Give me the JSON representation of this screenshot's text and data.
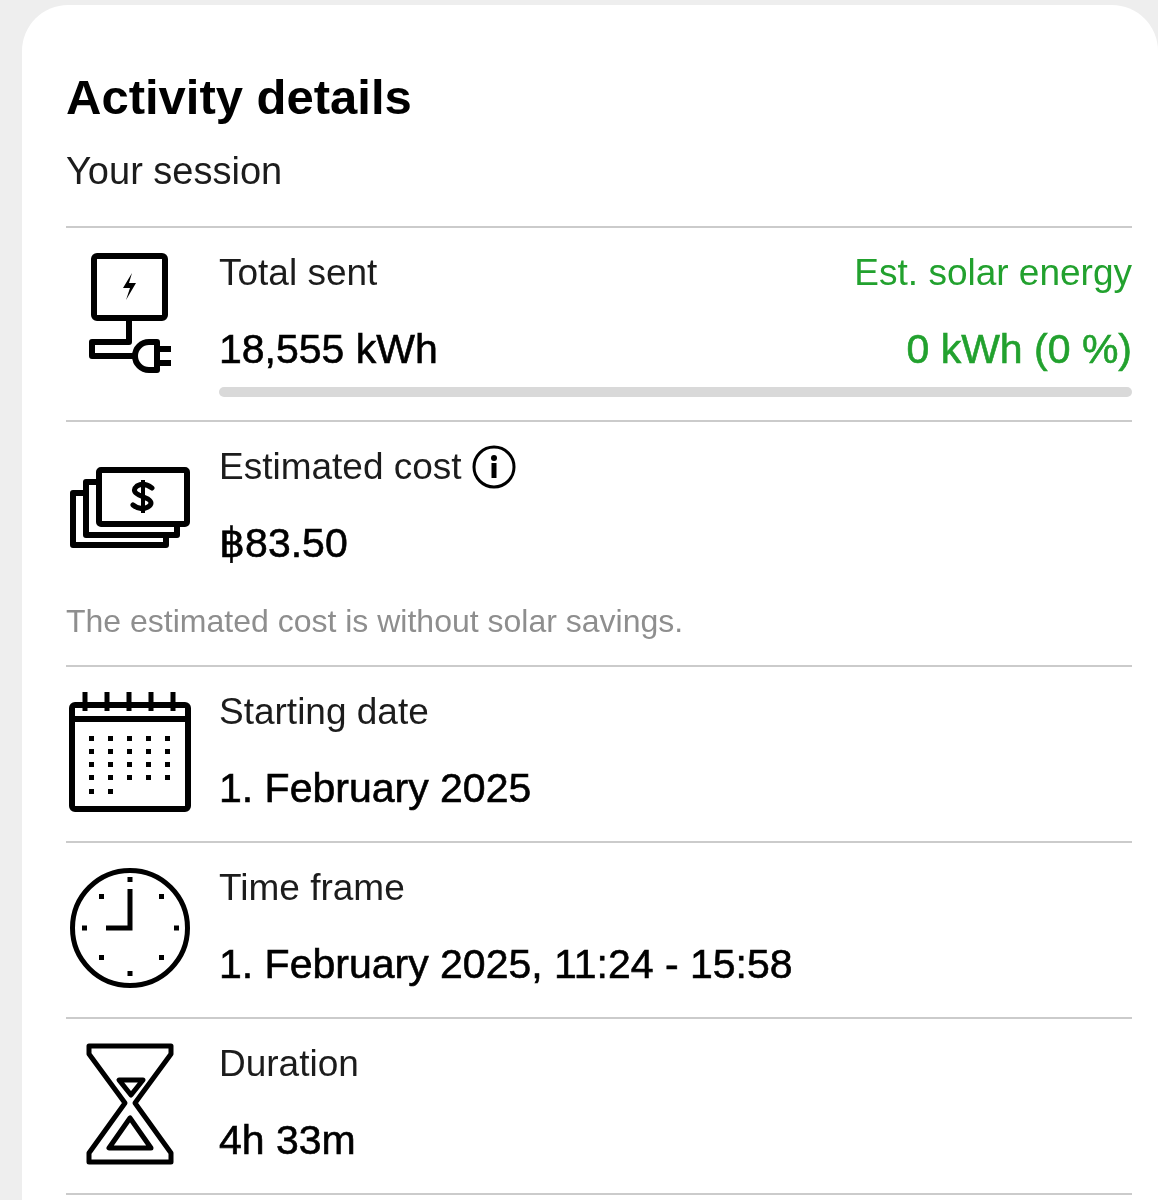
{
  "card": {
    "title": "Activity details",
    "subtitle": "Your session"
  },
  "rows": [
    {
      "kind": "energy",
      "label": "Total sent",
      "value": "18,555 kWh",
      "solar_label": "Est. solar energy",
      "solar_value": "0 kWh (0 %)",
      "level": 0
    },
    {
      "kind": "cost",
      "label": "Estimated cost",
      "value": "฿83.50",
      "note": "The estimated cost is without solar savings."
    },
    {
      "kind": "date",
      "label": "Starting date",
      "value": "1. February 2025"
    },
    {
      "kind": "timeframe",
      "label": "Time frame",
      "value": "1. February 2025, 11:24 - 15:58"
    },
    {
      "kind": "duration",
      "label": "Duration",
      "value": "4h 33m"
    }
  ]
}
